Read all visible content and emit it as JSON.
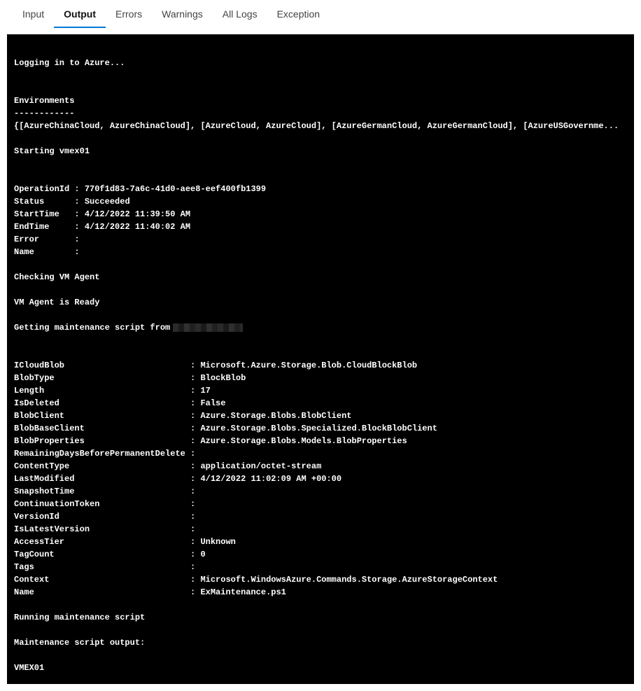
{
  "tabs": {
    "items": [
      {
        "label": "Input",
        "active": false
      },
      {
        "label": "Output",
        "active": true
      },
      {
        "label": "Errors",
        "active": false
      },
      {
        "label": "Warnings",
        "active": false
      },
      {
        "label": "All Logs",
        "active": false
      },
      {
        "label": "Exception",
        "active": false
      }
    ]
  },
  "log": {
    "login": "Logging in to Azure...",
    "env_header": "Environments",
    "env_divider": "------------",
    "env_list": "{[AzureChinaCloud, AzureChinaCloud], [AzureCloud, AzureCloud], [AzureGermanCloud, AzureGermanCloud], [AzureUSGovernme...",
    "starting": "Starting vmex01",
    "op": {
      "OperationId": "770f1d83-7a6c-41d0-aee8-eef400fb1399",
      "Status": "Succeeded",
      "StartTime": "4/12/2022 11:39:50 AM",
      "EndTime": "4/12/2022 11:40:02 AM",
      "Error": "",
      "Name": ""
    },
    "checking_vm": "Checking VM Agent",
    "vm_ready": "VM Agent is Ready",
    "getting_script": "Getting maintenance script from",
    "blob": {
      "ICloudBlob": "Microsoft.Azure.Storage.Blob.CloudBlockBlob",
      "BlobType": "BlockBlob",
      "Length": "17",
      "IsDeleted": "False",
      "BlobClient": "Azure.Storage.Blobs.BlobClient",
      "BlobBaseClient": "Azure.Storage.Blobs.Specialized.BlockBlobClient",
      "BlobProperties": "Azure.Storage.Blobs.Models.BlobProperties",
      "RemainingDaysBeforePermanentDelete": "",
      "ContentType": "application/octet-stream",
      "LastModified": "4/12/2022 11:02:09 AM +00:00",
      "SnapshotTime": "",
      "ContinuationToken": "",
      "VersionId": "",
      "IsLatestVersion": "",
      "AccessTier": "Unknown",
      "TagCount": "0",
      "Tags": "",
      "Context": "Microsoft.WindowsAzure.Commands.Storage.AzureStorageContext",
      "Name": "ExMaintenance.ps1"
    },
    "running": "Running maintenance script",
    "output_header": "Maintenance script output:",
    "vmname": "VMEX01"
  }
}
